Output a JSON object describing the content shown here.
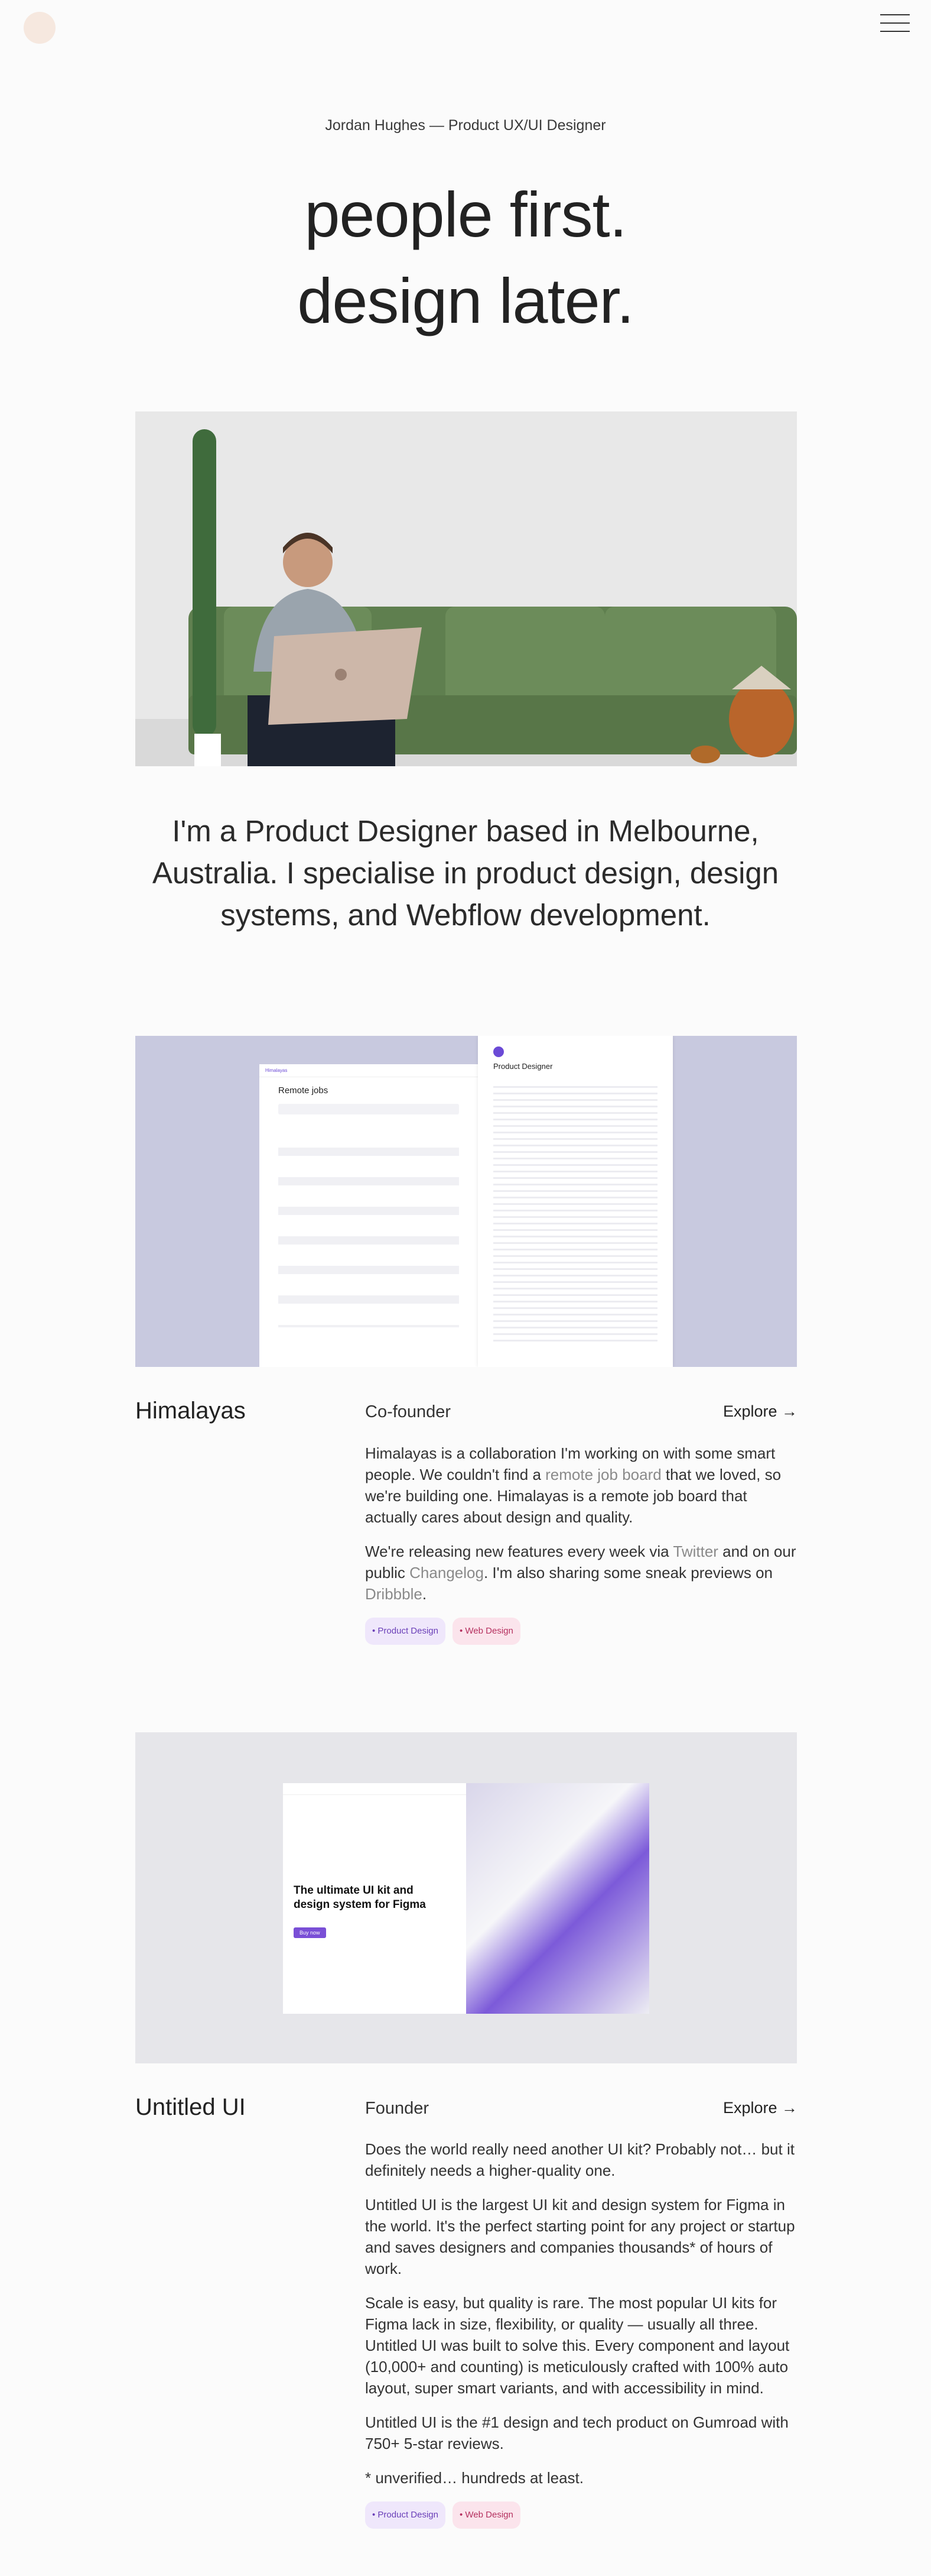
{
  "header": {
    "menu_icon": "hamburger-icon"
  },
  "hero": {
    "eyebrow": "Jordan Hughes — Product UX/UI Designer",
    "line1": "people first.",
    "line2": "design later."
  },
  "intro": "I'm a Product Designer based in Melbourne, Australia. I specialise in product design, design systems, and Webflow development.",
  "projects": [
    {
      "title": "Himalayas",
      "role": "Co-founder",
      "explore": "Explore →",
      "p1_a": "Himalayas is a collaboration I'm working on with some smart people. We couldn't find a ",
      "p1_link": "remote job board",
      "p1_b": " that we loved, so we're building one. Himalayas is a remote job board that actually cares about design and quality.",
      "p2_a": "We're releasing new features every week via ",
      "p2_link1": "Twitter",
      "p2_b": " and on our public ",
      "p2_link2": "Changelog",
      "p2_c": ". I'm also sharing some sneak previews on ",
      "p2_link3": "Dribbble",
      "p2_d": ".",
      "tags": [
        "• Product Design",
        "• Web Design"
      ],
      "mock": {
        "brand": "Himalayas",
        "page_title": "Remote jobs",
        "detail_title": "Product Designer"
      }
    },
    {
      "title": "Untitled UI",
      "role": "Founder",
      "explore": "Explore →",
      "p1": "Does the world really need another UI kit? Probably not… but it definitely needs a higher-quality one.",
      "p2": "Untitled UI is the largest UI kit and design system for Figma in the world. It's the perfect starting point for any project or startup and saves designers and companies thousands* of hours of work.",
      "p3": "Scale is easy, but quality is rare. The most popular UI kits for Figma lack in size, flexibility, or quality — usually all three. Untitled UI was built to solve this. Every component and layout (10,000+ and counting) is meticulously crafted with 100% auto layout, super smart variants, and with accessibility in mind.",
      "p4": "Untitled UI is the #1 design and tech product on Gumroad with 750+ 5-star reviews.",
      "p5": "* unverified… hundreds at least.",
      "tags": [
        "• Product Design",
        "• Web Design"
      ],
      "mock": {
        "headline1": "The ultimate UI kit and",
        "headline2": "design system for Figma",
        "cta": "Buy now"
      }
    }
  ],
  "colors": {
    "accent": "#7a4fd6",
    "himalayas_bg": "#c8c9df",
    "untitled_bg": "#e6e6ea"
  }
}
